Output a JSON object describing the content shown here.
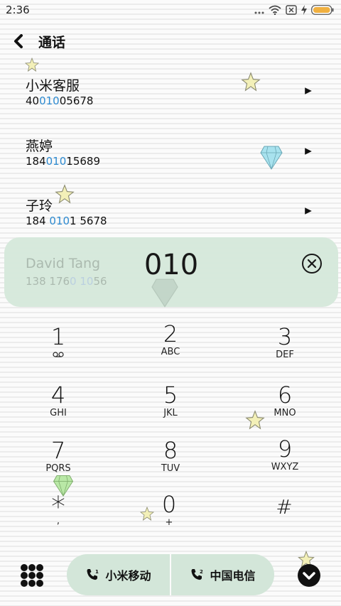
{
  "status_bar": {
    "time": "2:36"
  },
  "header": {
    "title": "通话"
  },
  "contacts": [
    {
      "name": "小米客服",
      "number_pre": "40",
      "number_hl": "010",
      "number_post": "05678"
    },
    {
      "name": "燕婷",
      "number_pre": "184",
      "number_hl": "010",
      "number_post": "15689"
    },
    {
      "name": "子玲",
      "number_pre": "184 ",
      "number_hl": "010",
      "number_post": "1 5678"
    }
  ],
  "match": {
    "name": "David Tang",
    "number_pre": "138 176",
    "number_hl": "0 10",
    "number_post": "56"
  },
  "dial_input": "010",
  "keys": [
    {
      "digit": "1",
      "letters": ""
    },
    {
      "digit": "2",
      "letters": "ABC"
    },
    {
      "digit": "3",
      "letters": "DEF"
    },
    {
      "digit": "4",
      "letters": "GHI"
    },
    {
      "digit": "5",
      "letters": "JKL"
    },
    {
      "digit": "6",
      "letters": "MNO"
    },
    {
      "digit": "7",
      "letters": "PQRS"
    },
    {
      "digit": "8",
      "letters": "TUV"
    },
    {
      "digit": "9",
      "letters": "WXYZ"
    },
    {
      "digit": "*",
      "letters": ","
    },
    {
      "digit": "0",
      "letters": "+"
    },
    {
      "digit": "#",
      "letters": ""
    }
  ],
  "sim_buttons": {
    "sim1": "小米移动",
    "sim2": "中国电信"
  },
  "colors": {
    "highlight": "#2e8bd1",
    "panel": "#d6e9dc",
    "sim_bg": "#d3e6d9",
    "battery": "#f0b040"
  },
  "icons": [
    "back-icon",
    "wifi-icon",
    "sim-x-icon",
    "charging-icon",
    "battery-icon",
    "play-arrow-icon",
    "clear-icon",
    "voicemail-icon",
    "grid-icon",
    "phone-sim1-icon",
    "phone-sim2-icon",
    "collapse-icon"
  ]
}
